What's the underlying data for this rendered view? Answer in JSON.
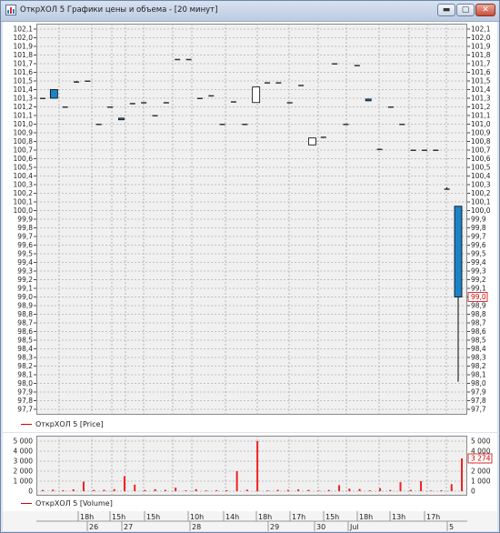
{
  "window": {
    "title": "ОткрХОЛ 5 Графики цены и объема - [20 минут]",
    "controls": {
      "minimize": "▬",
      "maximize": "▢",
      "close": "✕"
    },
    "icon": "chart-app-icon"
  },
  "price_legend": "ОткрХОЛ 5 [Price]",
  "volume_legend": "ОткрХОЛ 5 [Volume]",
  "price_axis_labels": [
    "102,1",
    "102,0",
    "101,9",
    "101,8",
    "101,7",
    "101,6",
    "101,5",
    "101,4",
    "101,3",
    "101,2",
    "101,1",
    "101,0",
    "100,9",
    "100,8",
    "100,7",
    "100,6",
    "100,5",
    "100,4",
    "100,3",
    "100,2",
    "100,1",
    "100,0",
    "99,9",
    "99,8",
    "99,7",
    "99,6",
    "99,5",
    "99,4",
    "99,3",
    "99,2",
    "99,1",
    "99,0",
    "98,9",
    "98,8",
    "98,7",
    "98,6",
    "98,5",
    "98,4",
    "98,3",
    "98,2",
    "98,1",
    "98,0",
    "97,9",
    "97,8",
    "97,7"
  ],
  "price_marker": "99,0",
  "volume_axis_labels": [
    "5 000",
    "4 000",
    "3 000",
    "2 000",
    "1 000",
    "0"
  ],
  "volume_marker": "3 274",
  "time_axis": {
    "hours": [
      "18h",
      "15h",
      "15h",
      "10h",
      "14h",
      "18h",
      "17h",
      "15h",
      "18h",
      "13h",
      "17h"
    ],
    "dates": [
      "26",
      "27",
      "28",
      "29",
      "30",
      "Jul",
      "5"
    ]
  },
  "colors": {
    "up": "#ffffff",
    "down": "#1e82c8",
    "volume": "#ee2222",
    "marker": "#d00000"
  },
  "chart_data": [
    {
      "type": "candlestick",
      "title": "",
      "ylim": [
        97.7,
        102.1
      ],
      "grid": true,
      "series_name": "ОткрХОЛ 5 [Price]",
      "candles": [
        {
          "o": 101.3,
          "h": 101.3,
          "l": 101.3,
          "c": 101.3
        },
        {
          "o": 101.4,
          "h": 101.4,
          "l": 101.3,
          "c": 101.3
        },
        {
          "o": 101.2,
          "h": 101.2,
          "l": 101.2,
          "c": 101.2
        },
        {
          "o": 101.49,
          "h": 101.5,
          "l": 101.48,
          "c": 101.49
        },
        {
          "o": 101.5,
          "h": 101.5,
          "l": 101.5,
          "c": 101.5
        },
        {
          "o": 101.0,
          "h": 101.0,
          "l": 101.0,
          "c": 101.0
        },
        {
          "o": 101.2,
          "h": 101.2,
          "l": 101.2,
          "c": 101.2
        },
        {
          "o": 101.07,
          "h": 101.07,
          "l": 101.05,
          "c": 101.05
        },
        {
          "o": 101.24,
          "h": 101.24,
          "l": 101.23,
          "c": 101.24
        },
        {
          "o": 101.25,
          "h": 101.25,
          "l": 101.25,
          "c": 101.25
        },
        {
          "o": 101.1,
          "h": 101.1,
          "l": 101.1,
          "c": 101.1
        },
        {
          "o": 101.25,
          "h": 101.25,
          "l": 101.25,
          "c": 101.25
        },
        {
          "o": 101.75,
          "h": 101.75,
          "l": 101.75,
          "c": 101.75
        },
        {
          "o": 101.75,
          "h": 101.75,
          "l": 101.75,
          "c": 101.75
        },
        {
          "o": 101.3,
          "h": 101.3,
          "l": 101.3,
          "c": 101.3
        },
        {
          "o": 101.33,
          "h": 101.33,
          "l": 101.33,
          "c": 101.33
        },
        {
          "o": 101.0,
          "h": 101.0,
          "l": 101.0,
          "c": 101.0
        },
        {
          "o": 101.26,
          "h": 101.26,
          "l": 101.26,
          "c": 101.26
        },
        {
          "o": 101.0,
          "h": 101.0,
          "l": 101.0,
          "c": 101.0
        },
        {
          "o": 101.25,
          "h": 101.43,
          "l": 101.25,
          "c": 101.43
        },
        {
          "o": 101.48,
          "h": 101.48,
          "l": 101.48,
          "c": 101.48
        },
        {
          "o": 101.48,
          "h": 101.48,
          "l": 101.48,
          "c": 101.48
        },
        {
          "o": 101.25,
          "h": 101.25,
          "l": 101.25,
          "c": 101.25
        },
        {
          "o": 101.45,
          "h": 101.45,
          "l": 101.45,
          "c": 101.45
        },
        {
          "o": 100.76,
          "h": 100.84,
          "l": 100.76,
          "c": 100.84
        },
        {
          "o": 100.85,
          "h": 100.85,
          "l": 100.84,
          "c": 100.84
        },
        {
          "o": 101.7,
          "h": 101.7,
          "l": 101.7,
          "c": 101.7
        },
        {
          "o": 101.0,
          "h": 101.0,
          "l": 101.0,
          "c": 101.0
        },
        {
          "o": 101.68,
          "h": 101.68,
          "l": 101.68,
          "c": 101.68
        },
        {
          "o": 101.29,
          "h": 101.29,
          "l": 101.27,
          "c": 101.27
        },
        {
          "o": 100.71,
          "h": 100.71,
          "l": 100.7,
          "c": 100.7
        },
        {
          "o": 101.2,
          "h": 101.2,
          "l": 101.2,
          "c": 101.2
        },
        {
          "o": 101.0,
          "h": 101.0,
          "l": 101.0,
          "c": 101.0
        },
        {
          "o": 100.7,
          "h": 100.7,
          "l": 100.7,
          "c": 100.7
        },
        {
          "o": 100.7,
          "h": 100.7,
          "l": 100.7,
          "c": 100.7
        },
        {
          "o": 100.7,
          "h": 100.7,
          "l": 100.7,
          "c": 100.7
        },
        {
          "o": 100.25,
          "h": 100.27,
          "l": 100.24,
          "c": 100.25
        },
        {
          "o": 100.05,
          "h": 100.05,
          "l": 98.02,
          "c": 99.0
        }
      ]
    },
    {
      "type": "bar",
      "title": "",
      "ylim": [
        0,
        5000
      ],
      "series_name": "ОткрХОЛ 5 [Volume]",
      "values": [
        120,
        150,
        100,
        180,
        950,
        120,
        130,
        200,
        1500,
        650,
        120,
        200,
        130,
        350,
        80,
        200,
        70,
        100,
        100,
        2000,
        150,
        5000,
        70,
        130,
        130,
        180,
        130,
        50,
        120,
        600,
        250,
        220,
        80,
        300,
        120,
        900,
        130,
        1000,
        60,
        100,
        700,
        3274
      ]
    }
  ]
}
